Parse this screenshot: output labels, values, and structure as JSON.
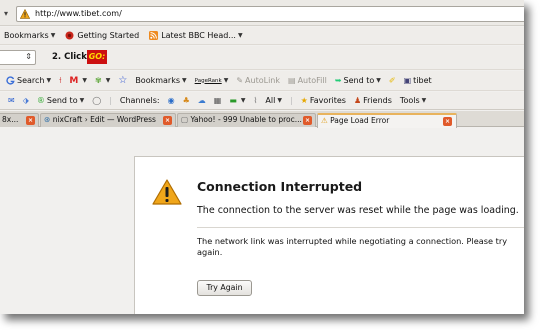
{
  "address_bar": {
    "url": "http://www.tibet.com/"
  },
  "bookmarks_toolbar": {
    "items": [
      {
        "label": "Bookmarks",
        "icon": "chevron-down-icon"
      },
      {
        "label": "Getting Started",
        "icon": "getting-started-icon"
      },
      {
        "label": "Latest BBC Head...",
        "icon": "rss-feed-icon"
      }
    ]
  },
  "google_bar": {
    "step_label": "2. Click",
    "go_label": "GO:"
  },
  "search_toolbar": {
    "search_label": "Search",
    "bookmarks_label": "Bookmarks",
    "pagerank_label": "PageRank",
    "autolink_label": "AutoLink",
    "autofill_label": "AutoFill",
    "sendto_label": "Send to",
    "tibet_label": "tibet"
  },
  "messenger_toolbar": {
    "sendto_label": "Send to",
    "channels_label": "Channels:",
    "all_label": "All",
    "favorites_label": "Favorites",
    "friends_label": "Friends",
    "tools_label": "Tools"
  },
  "tabs": [
    {
      "label": "8x..."
    },
    {
      "label": "nixCraft › Edit — WordPress"
    },
    {
      "label": "Yahoo! - 999 Unable to proc..."
    },
    {
      "label": "Page Load Error"
    }
  ],
  "error_page": {
    "title": "Connection Interrupted",
    "short_desc": "The connection to the server was reset while the page was loading.",
    "long_desc": "The network link was interrupted while negotiating a connection. Please try again.",
    "try_again_label": "Try Again"
  },
  "colors": {
    "warning": "#f0a61a",
    "go_button": "#cc1010",
    "tab_close": "#e05a2a"
  }
}
